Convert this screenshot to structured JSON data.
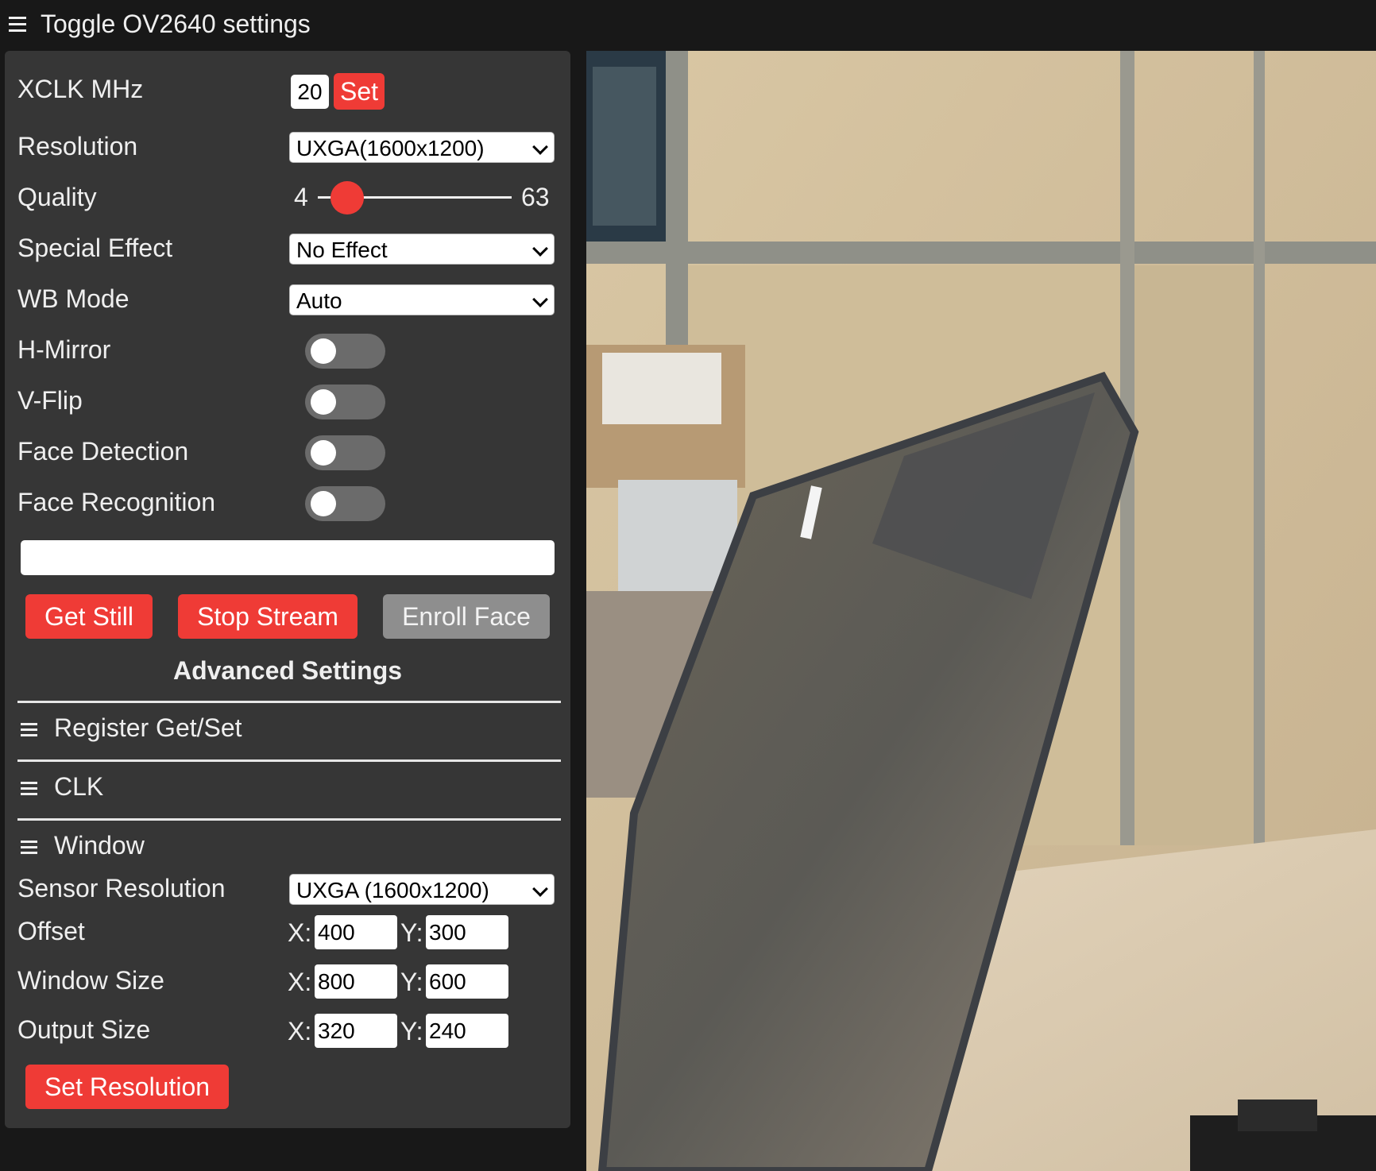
{
  "header": {
    "menu_icon": "hamburger-icon",
    "title": "Toggle OV2640 settings"
  },
  "sidebar": {
    "xclk": {
      "label": "XCLK MHz",
      "value": "20",
      "button": "Set"
    },
    "resolution": {
      "label": "Resolution",
      "selected": "UXGA(1600x1200)"
    },
    "quality": {
      "label": "Quality",
      "min": "4",
      "max": "63",
      "value": 4
    },
    "special_effect": {
      "label": "Special Effect",
      "selected": "No Effect"
    },
    "wb_mode": {
      "label": "WB Mode",
      "selected": "Auto"
    },
    "toggles": [
      {
        "label": "H-Mirror",
        "on": false
      },
      {
        "label": "V-Flip",
        "on": false
      },
      {
        "label": "Face Detection",
        "on": false
      },
      {
        "label": "Face Recognition",
        "on": false
      }
    ],
    "text_input": {
      "value": ""
    },
    "buttons": {
      "get_still": "Get Still",
      "stop_stream": "Stop Stream",
      "enroll_face": "Enroll Face"
    },
    "advanced": {
      "heading": "Advanced Settings",
      "sections": [
        "Register Get/Set",
        "CLK",
        "Window"
      ]
    },
    "window": {
      "sensor_resolution": {
        "label": "Sensor Resolution",
        "selected": "UXGA (1600x1200)"
      },
      "offset": {
        "label": "Offset",
        "x": "400",
        "y": "300"
      },
      "window_size": {
        "label": "Window Size",
        "x": "800",
        "y": "600"
      },
      "output_size": {
        "label": "Output Size",
        "x": "320",
        "y": "240"
      },
      "x_label": "X:",
      "y_label": "Y:",
      "set_resolution": "Set Resolution"
    }
  },
  "colors": {
    "accent": "#ef3b36",
    "panel": "#363636",
    "background": "#181818",
    "disabled_button": "#8e8e8e"
  }
}
